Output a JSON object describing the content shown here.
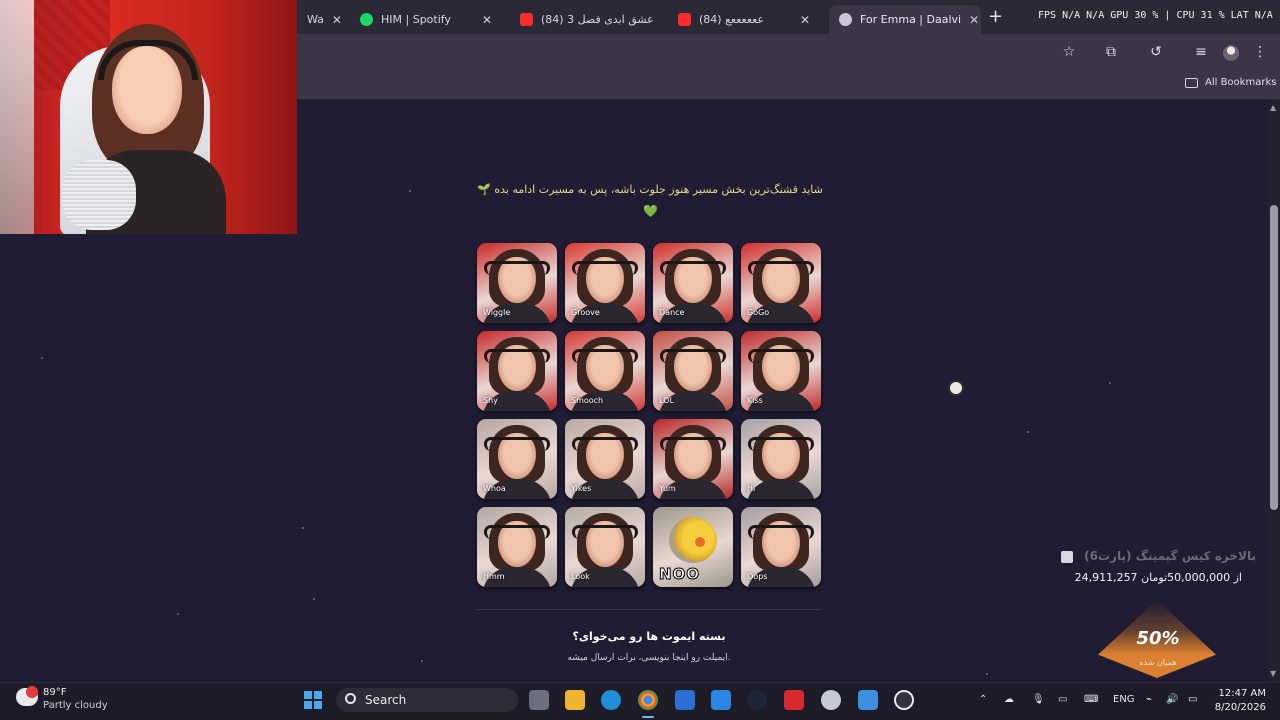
{
  "browser": {
    "tabs": [
      {
        "label": "Wa",
        "favicon_color": "#e9e9e9",
        "active": false
      },
      {
        "label": "HIM | Spotify",
        "favicon_color": "#1ed760",
        "active": false
      },
      {
        "label": "(84) عشق ابدی فصل 3",
        "favicon_color": "#ff2b2b",
        "active": false
      },
      {
        "label": "(84) ععععععع",
        "favicon_color": "#ff2b2b",
        "active": false
      },
      {
        "label": "For Emma | Daalvi",
        "favicon_color": "#c9c6d6",
        "active": true
      }
    ],
    "perf_overlay": "FPS N/A N/A GPU 30 % | CPU 31 % LAT N/A",
    "bookmarks_label": "All Bookmarks"
  },
  "page": {
    "message": "شاید قشنگ‌ترین بخش مسیر هنوز جلوت باشه، پس به مسیرت ادامه بده",
    "heart": "💚",
    "emotes": [
      {
        "label": "Wiggle",
        "bg": "#c92a2a"
      },
      {
        "label": "Groove",
        "bg": "#d83a33"
      },
      {
        "label": "Dance",
        "bg": "#cf302b"
      },
      {
        "label": "GoGo",
        "bg": "#d12d2d"
      },
      {
        "label": "Shy",
        "bg": "#c8292b"
      },
      {
        "label": "Smooch",
        "bg": "#d23a35"
      },
      {
        "label": "LOL",
        "bg": "#c34f44"
      },
      {
        "label": "Kiss",
        "bg": "#c02a2c"
      },
      {
        "label": "Whoa",
        "bg": "#b9a6a2"
      },
      {
        "label": "Yikes",
        "bg": "#b8a9a3"
      },
      {
        "label": "Yum",
        "bg": "#b62626"
      },
      {
        "label": "Hi",
        "bg": "#a7a2a5"
      },
      {
        "label": "Hmm",
        "bg": "#b1a7a3"
      },
      {
        "label": "Look",
        "bg": "#b4aaa4"
      },
      {
        "label": "NOO",
        "bg": "#9d978a"
      },
      {
        "label": "Oops",
        "bg": "#a79ea0"
      }
    ],
    "pack_title": "بسته ایموت ها رو می‌خوای؟",
    "pack_subtitle": "ایمیلت رو اینجا بنویسی، برات ارسال میشه."
  },
  "donation": {
    "title": "بالاخره کیس گیمینگ (پارت6)",
    "amount": "24,911,257 از 50,000,000تومان",
    "percent": "50%",
    "percent_sub": "همیان شده"
  },
  "taskbar": {
    "weather_temp": "89°F",
    "weather_desc": "Partly cloudy",
    "search_label": "Search",
    "lang": "ENG",
    "time": "12:47 AM",
    "date": "8/20/2026"
  }
}
